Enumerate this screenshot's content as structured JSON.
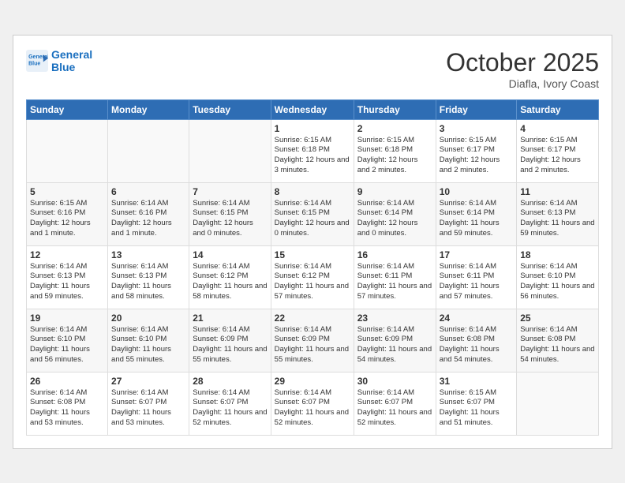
{
  "header": {
    "logo_line1": "General",
    "logo_line2": "Blue",
    "month": "October 2025",
    "location": "Diafla, Ivory Coast"
  },
  "days_of_week": [
    "Sunday",
    "Monday",
    "Tuesday",
    "Wednesday",
    "Thursday",
    "Friday",
    "Saturday"
  ],
  "weeks": [
    [
      {
        "day": "",
        "info": ""
      },
      {
        "day": "",
        "info": ""
      },
      {
        "day": "",
        "info": ""
      },
      {
        "day": "1",
        "info": "Sunrise: 6:15 AM\nSunset: 6:18 PM\nDaylight: 12 hours and 3 minutes."
      },
      {
        "day": "2",
        "info": "Sunrise: 6:15 AM\nSunset: 6:18 PM\nDaylight: 12 hours and 2 minutes."
      },
      {
        "day": "3",
        "info": "Sunrise: 6:15 AM\nSunset: 6:17 PM\nDaylight: 12 hours and 2 minutes."
      },
      {
        "day": "4",
        "info": "Sunrise: 6:15 AM\nSunset: 6:17 PM\nDaylight: 12 hours and 2 minutes."
      }
    ],
    [
      {
        "day": "5",
        "info": "Sunrise: 6:15 AM\nSunset: 6:16 PM\nDaylight: 12 hours and 1 minute."
      },
      {
        "day": "6",
        "info": "Sunrise: 6:14 AM\nSunset: 6:16 PM\nDaylight: 12 hours and 1 minute."
      },
      {
        "day": "7",
        "info": "Sunrise: 6:14 AM\nSunset: 6:15 PM\nDaylight: 12 hours and 0 minutes."
      },
      {
        "day": "8",
        "info": "Sunrise: 6:14 AM\nSunset: 6:15 PM\nDaylight: 12 hours and 0 minutes."
      },
      {
        "day": "9",
        "info": "Sunrise: 6:14 AM\nSunset: 6:14 PM\nDaylight: 12 hours and 0 minutes."
      },
      {
        "day": "10",
        "info": "Sunrise: 6:14 AM\nSunset: 6:14 PM\nDaylight: 11 hours and 59 minutes."
      },
      {
        "day": "11",
        "info": "Sunrise: 6:14 AM\nSunset: 6:13 PM\nDaylight: 11 hours and 59 minutes."
      }
    ],
    [
      {
        "day": "12",
        "info": "Sunrise: 6:14 AM\nSunset: 6:13 PM\nDaylight: 11 hours and 59 minutes."
      },
      {
        "day": "13",
        "info": "Sunrise: 6:14 AM\nSunset: 6:13 PM\nDaylight: 11 hours and 58 minutes."
      },
      {
        "day": "14",
        "info": "Sunrise: 6:14 AM\nSunset: 6:12 PM\nDaylight: 11 hours and 58 minutes."
      },
      {
        "day": "15",
        "info": "Sunrise: 6:14 AM\nSunset: 6:12 PM\nDaylight: 11 hours and 57 minutes."
      },
      {
        "day": "16",
        "info": "Sunrise: 6:14 AM\nSunset: 6:11 PM\nDaylight: 11 hours and 57 minutes."
      },
      {
        "day": "17",
        "info": "Sunrise: 6:14 AM\nSunset: 6:11 PM\nDaylight: 11 hours and 57 minutes."
      },
      {
        "day": "18",
        "info": "Sunrise: 6:14 AM\nSunset: 6:10 PM\nDaylight: 11 hours and 56 minutes."
      }
    ],
    [
      {
        "day": "19",
        "info": "Sunrise: 6:14 AM\nSunset: 6:10 PM\nDaylight: 11 hours and 56 minutes."
      },
      {
        "day": "20",
        "info": "Sunrise: 6:14 AM\nSunset: 6:10 PM\nDaylight: 11 hours and 55 minutes."
      },
      {
        "day": "21",
        "info": "Sunrise: 6:14 AM\nSunset: 6:09 PM\nDaylight: 11 hours and 55 minutes."
      },
      {
        "day": "22",
        "info": "Sunrise: 6:14 AM\nSunset: 6:09 PM\nDaylight: 11 hours and 55 minutes."
      },
      {
        "day": "23",
        "info": "Sunrise: 6:14 AM\nSunset: 6:09 PM\nDaylight: 11 hours and 54 minutes."
      },
      {
        "day": "24",
        "info": "Sunrise: 6:14 AM\nSunset: 6:08 PM\nDaylight: 11 hours and 54 minutes."
      },
      {
        "day": "25",
        "info": "Sunrise: 6:14 AM\nSunset: 6:08 PM\nDaylight: 11 hours and 54 minutes."
      }
    ],
    [
      {
        "day": "26",
        "info": "Sunrise: 6:14 AM\nSunset: 6:08 PM\nDaylight: 11 hours and 53 minutes."
      },
      {
        "day": "27",
        "info": "Sunrise: 6:14 AM\nSunset: 6:07 PM\nDaylight: 11 hours and 53 minutes."
      },
      {
        "day": "28",
        "info": "Sunrise: 6:14 AM\nSunset: 6:07 PM\nDaylight: 11 hours and 52 minutes."
      },
      {
        "day": "29",
        "info": "Sunrise: 6:14 AM\nSunset: 6:07 PM\nDaylight: 11 hours and 52 minutes."
      },
      {
        "day": "30",
        "info": "Sunrise: 6:14 AM\nSunset: 6:07 PM\nDaylight: 11 hours and 52 minutes."
      },
      {
        "day": "31",
        "info": "Sunrise: 6:15 AM\nSunset: 6:07 PM\nDaylight: 11 hours and 51 minutes."
      },
      {
        "day": "",
        "info": ""
      }
    ]
  ]
}
